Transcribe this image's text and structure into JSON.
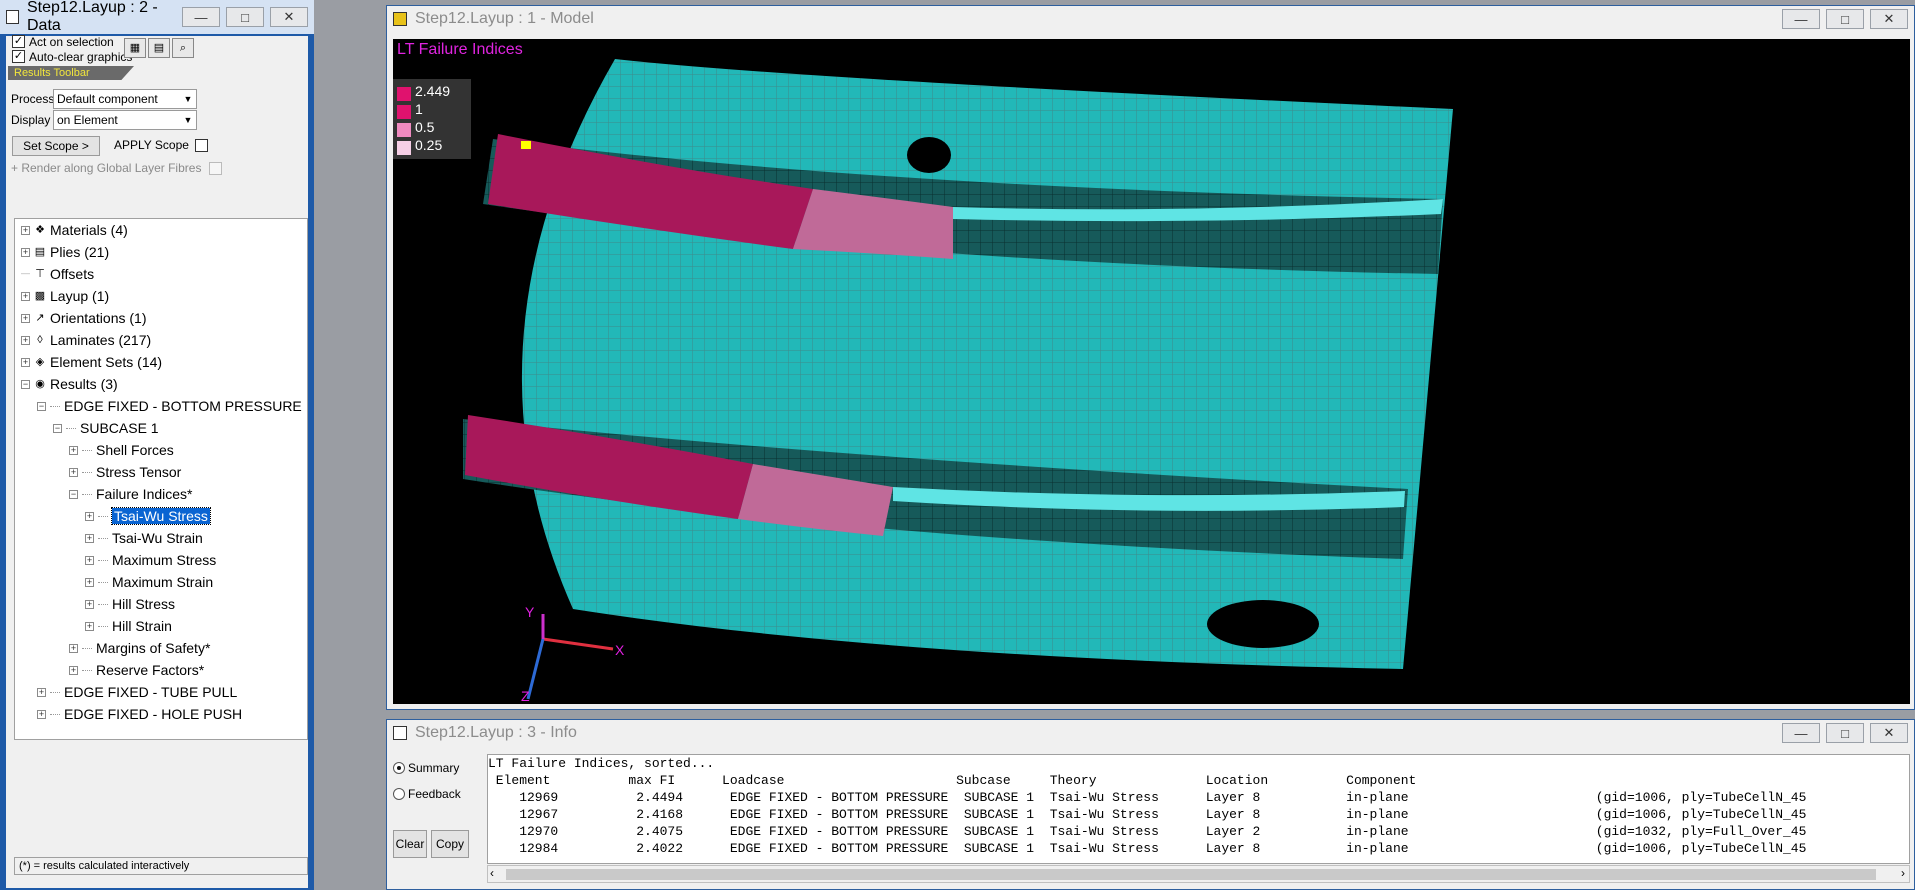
{
  "data_window": {
    "title": "Step12.Layup : 2 - Data",
    "act_on_selection": "Act on selection",
    "auto_clear": "Auto-clear graphics",
    "results_toolbar": "Results Toolbar",
    "process_label": "Process",
    "process_value": "Default component",
    "display_label": "Display",
    "display_value": "on Element",
    "set_scope": "Set Scope  >",
    "apply_scope": "APPLY Scope",
    "render_fibres": "+ Render along Global Layer Fibres",
    "status": "(*) = results calculated interactively",
    "tree": [
      {
        "label": "Materials (4)",
        "indent": 0,
        "exp": "+",
        "icon": "materials-icon"
      },
      {
        "label": "Plies (21)",
        "indent": 0,
        "exp": "+",
        "icon": "plies-icon"
      },
      {
        "label": "Offsets",
        "indent": 0,
        "exp": "",
        "icon": "offsets-icon"
      },
      {
        "label": "Layup (1)",
        "indent": 0,
        "exp": "+",
        "icon": "layup-icon"
      },
      {
        "label": "Orientations (1)",
        "indent": 0,
        "exp": "+",
        "icon": "orientation-arrow-icon"
      },
      {
        "label": "Laminates (217)",
        "indent": 0,
        "exp": "+",
        "icon": "laminates-icon"
      },
      {
        "label": "Element Sets (14)",
        "indent": 0,
        "exp": "+",
        "icon": "element-sets-icon"
      },
      {
        "label": "Results (3)",
        "indent": 0,
        "exp": "-",
        "icon": "results-icon"
      },
      {
        "label": "EDGE FIXED - BOTTOM PRESSURE",
        "indent": 1,
        "exp": "-",
        "icon": ""
      },
      {
        "label": "SUBCASE 1",
        "indent": 2,
        "exp": "-",
        "icon": ""
      },
      {
        "label": "Shell Forces",
        "indent": 3,
        "exp": "+",
        "icon": ""
      },
      {
        "label": "Stress Tensor",
        "indent": 3,
        "exp": "+",
        "icon": ""
      },
      {
        "label": "Failure Indices*",
        "indent": 3,
        "exp": "-",
        "icon": ""
      },
      {
        "label": "Tsai-Wu Stress",
        "indent": 4,
        "exp": "+",
        "icon": "",
        "selected": true
      },
      {
        "label": "Tsai-Wu Strain",
        "indent": 4,
        "exp": "+",
        "icon": ""
      },
      {
        "label": "Maximum Stress",
        "indent": 4,
        "exp": "+",
        "icon": ""
      },
      {
        "label": "Maximum Strain",
        "indent": 4,
        "exp": "+",
        "icon": ""
      },
      {
        "label": "Hill Stress",
        "indent": 4,
        "exp": "+",
        "icon": ""
      },
      {
        "label": "Hill Strain",
        "indent": 4,
        "exp": "+",
        "icon": ""
      },
      {
        "label": "Margins of Safety*",
        "indent": 3,
        "exp": "+",
        "icon": ""
      },
      {
        "label": "Reserve Factors*",
        "indent": 3,
        "exp": "+",
        "icon": ""
      },
      {
        "label": "EDGE FIXED - TUBE PULL",
        "indent": 1,
        "exp": "+",
        "icon": ""
      },
      {
        "label": "EDGE FIXED - HOLE PUSH",
        "indent": 1,
        "exp": "+",
        "icon": ""
      }
    ]
  },
  "model_window": {
    "title": "Step12.Layup : 1 - Model",
    "viewport_title": "LT Failure Indices",
    "legend": [
      {
        "label": "2.449",
        "color": "#e0126e"
      },
      {
        "label": "1",
        "color": "#e0126e"
      },
      {
        "label": "0.5",
        "color": "#f08ac0"
      },
      {
        "label": "0.25",
        "color": "#f6cfe6"
      }
    ],
    "axes": {
      "x": "X",
      "y": "Y",
      "z": "Z"
    },
    "colors": {
      "mesh": "#22b8b8",
      "hot": "#e0126e",
      "mid": "#f08ac0",
      "low": "#f6cfe6",
      "peak": "#ffff00"
    }
  },
  "info_window": {
    "title": "Step12.Layup : 3 - Info",
    "summary": "Summary",
    "feedback": "Feedback",
    "clear": "Clear",
    "copy": "Copy",
    "lines": [
      "LT Failure Indices, sorted...",
      " Element          max FI      Loadcase                      Subcase     Theory              Location          Component                                      ",
      "    12969          2.4494      EDGE FIXED - BOTTOM PRESSURE  SUBCASE 1  Tsai-Wu Stress      Layer 8           in-plane                        (gid=1006, ply=TubeCellN_45",
      "    12967          2.4168      EDGE FIXED - BOTTOM PRESSURE  SUBCASE 1  Tsai-Wu Stress      Layer 8           in-plane                        (gid=1006, ply=TubeCellN_45",
      "    12970          2.4075      EDGE FIXED - BOTTOM PRESSURE  SUBCASE 1  Tsai-Wu Stress      Layer 2           in-plane                        (gid=1032, ply=Full_Over_45",
      "    12984          2.4022      EDGE FIXED - BOTTOM PRESSURE  SUBCASE 1  Tsai-Wu Stress      Layer 8           in-plane                        (gid=1006, ply=TubeCellN_45"
    ]
  }
}
